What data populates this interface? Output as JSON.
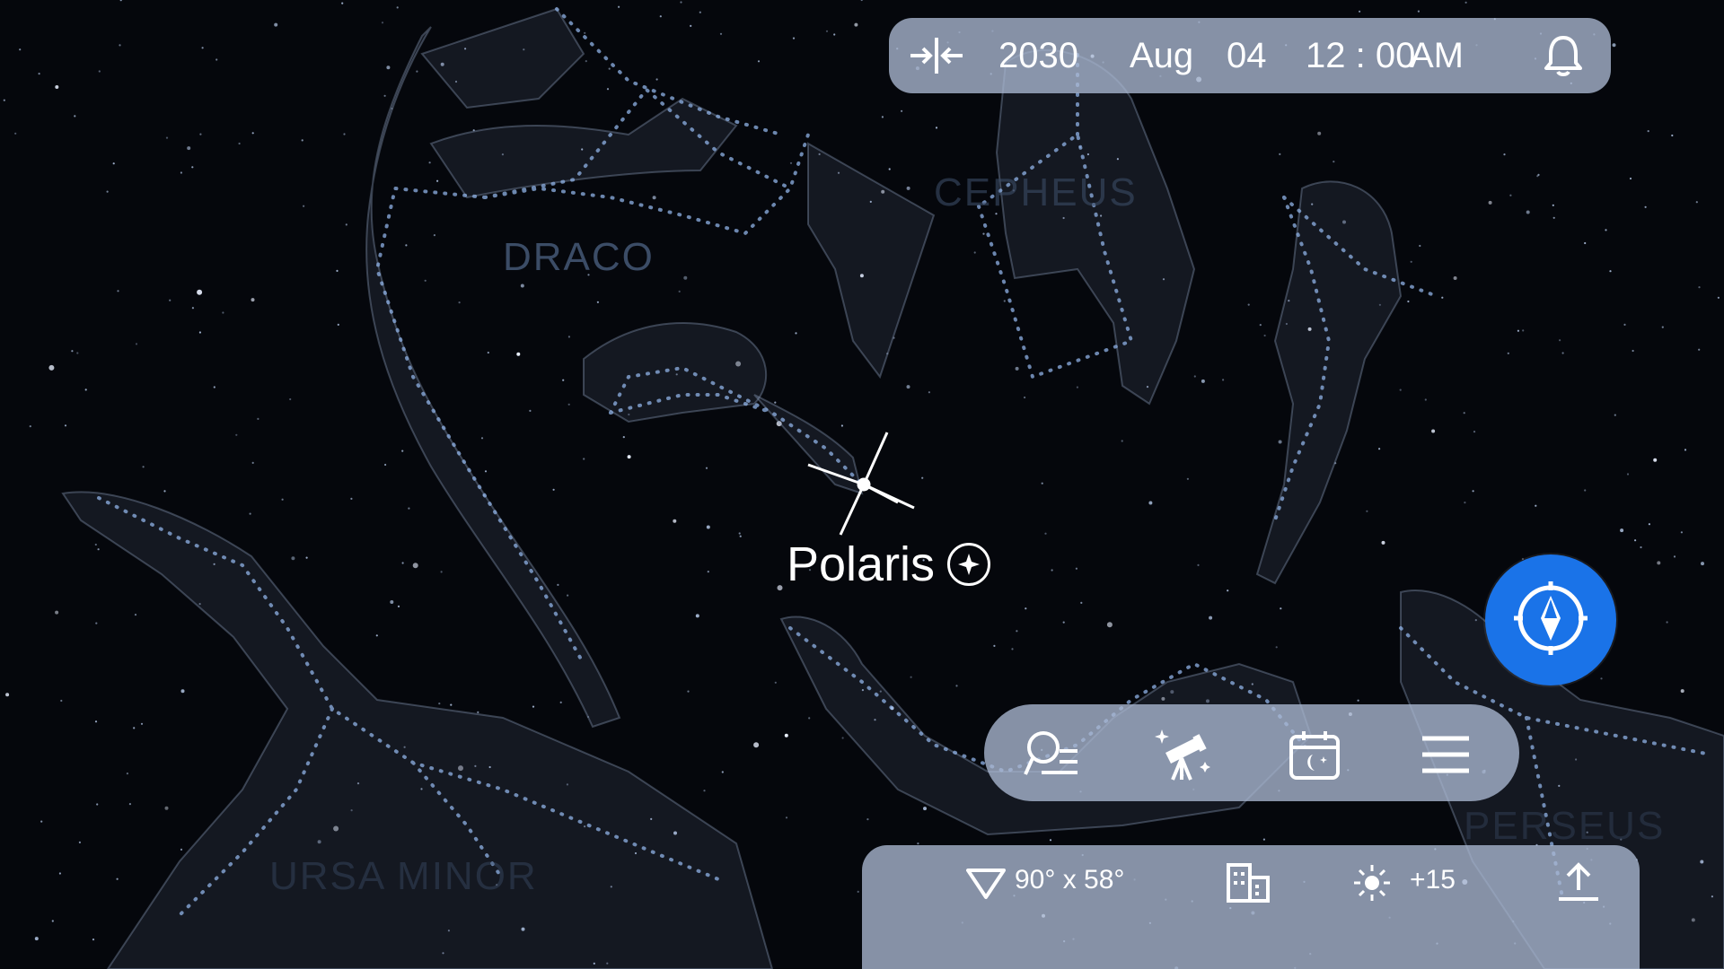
{
  "topbar": {
    "year": "2030",
    "month": "Aug",
    "day": "04",
    "time": "12 : 00",
    "ampm": "AM",
    "icons": [
      "time-travel-icon",
      "bell-icon"
    ]
  },
  "labels": {
    "draco": "DRACO",
    "cepheus": "CEPHEUS",
    "ursa_minor": "URSA MINOR",
    "perseus": "PERSEUS",
    "polaris": "Polaris"
  },
  "toolbar": {
    "icons": [
      "search-list-icon",
      "telescope-icon",
      "calendar-night-icon",
      "menu-icon"
    ]
  },
  "statusbar": {
    "fov": "90° x 58°",
    "brightness": "+15",
    "icons": [
      "field-of-view-icon",
      "buildings-icon",
      "sun-icon",
      "share-icon"
    ]
  },
  "compass": {
    "icon": "compass-icon"
  },
  "colors": {
    "background": "#05070c",
    "panel": "#aab9d2",
    "accent": "#1a73e8",
    "constellation_line": "#8fb2e6"
  }
}
